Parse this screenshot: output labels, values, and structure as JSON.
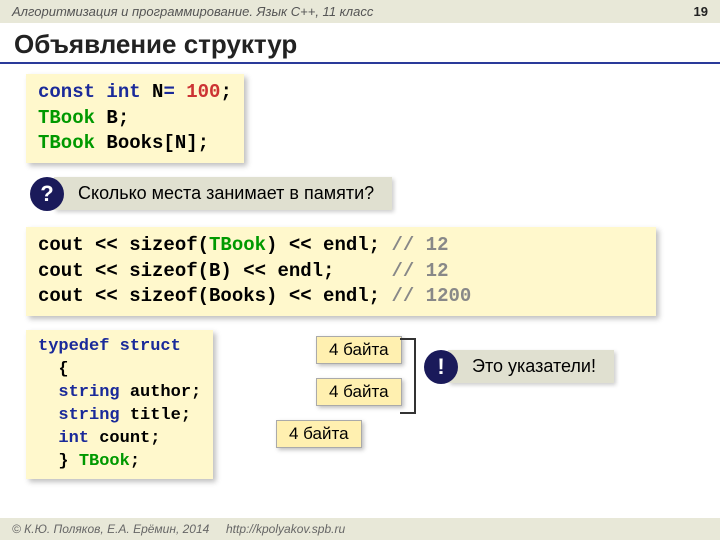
{
  "header": {
    "course": "Алгоритмизация и программирование. Язык C++, 11 класс",
    "page": "19"
  },
  "title": "Объявление структур",
  "code1": {
    "l1a": "const int",
    "l1b": " N",
    "l1c": "=",
    "l1d": " 100",
    "l1e": ";",
    "l2a": "TBook",
    "l2b": " B;",
    "l3a": "TBook",
    "l3b": " Books[N];"
  },
  "question": {
    "mark": "?",
    "text": "Сколько места занимает в памяти?"
  },
  "code2": {
    "l1a": "cout << sizeof(",
    "l1b": "TBook",
    "l1c": ") << endl; ",
    "l1d": "// 12",
    "l2a": "cout << sizeof(B) << endl;     ",
    "l2d": "// 12",
    "l3a": "cout << sizeof(Books) << endl; ",
    "l3d": "// 1200"
  },
  "code3": {
    "l1": "typedef struct",
    "l2": "  {",
    "l3a": "  ",
    "l3b": "string",
    "l3c": " author;",
    "l4a": "  ",
    "l4b": "string",
    "l4c": " title;",
    "l5a": "  ",
    "l5b": "int",
    "l5c": " count;",
    "l6a": "  } ",
    "l6b": "TBook",
    "l6c": ";"
  },
  "callouts": {
    "c1": "4 байта",
    "c2": "4 байта",
    "c3": "4 байта"
  },
  "excl": {
    "mark": "!",
    "text": "Это указатели!"
  },
  "footer": {
    "copy": "© К.Ю. Поляков, Е.А. Ерёмин, 2014",
    "url": "http://kpolyakov.spb.ru"
  }
}
